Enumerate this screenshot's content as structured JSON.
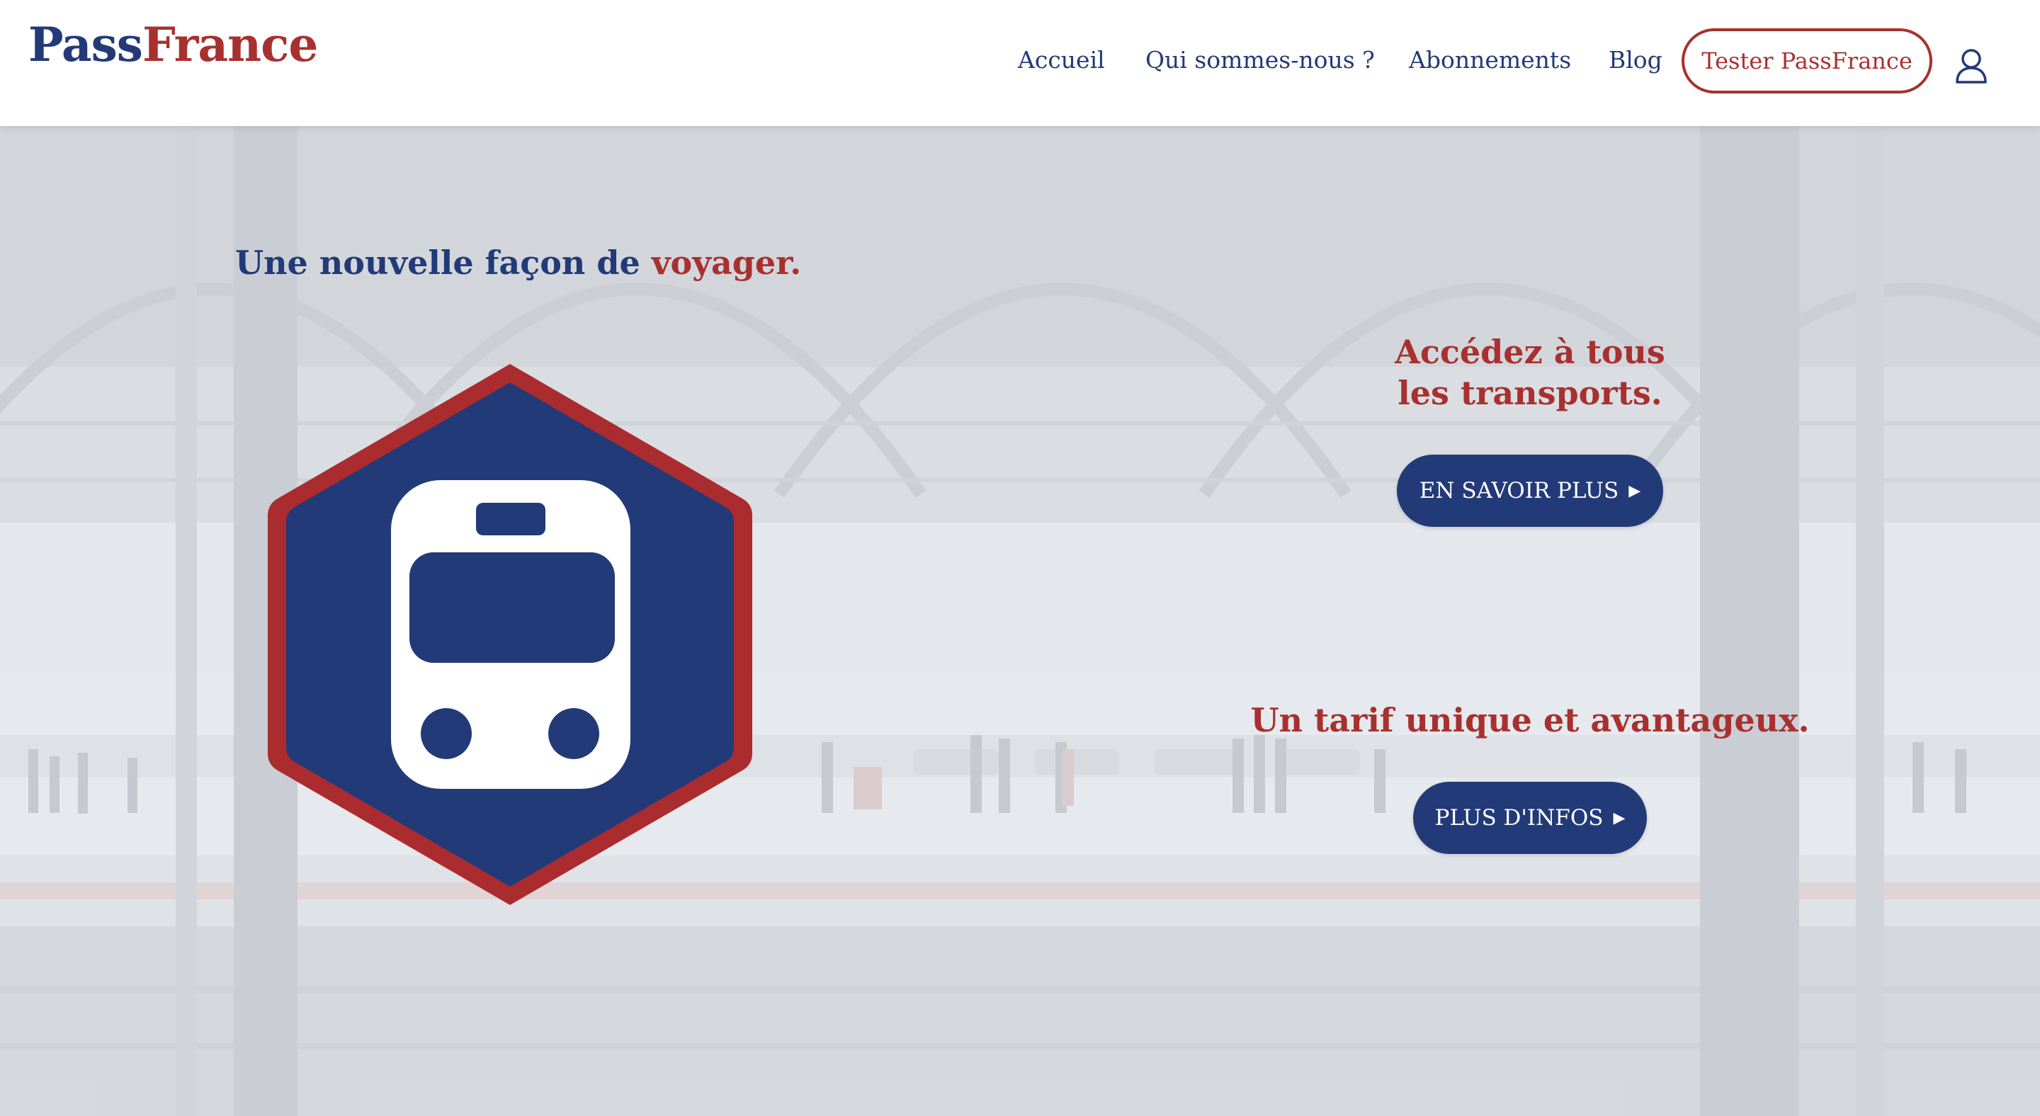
{
  "header": {
    "logo_part1": "Pass",
    "logo_part2": "France",
    "nav": [
      "Accueil",
      "Qui sommes-nous ?",
      "Abonnements",
      "Blog"
    ],
    "cta_label": "Tester PassFrance",
    "user_icon": "user-icon"
  },
  "hero": {
    "tagline_start": "Une nouvelle façon de ",
    "tagline_highlight": "voyager.",
    "badge_icon": "train-icon",
    "feature1_line1": "Accédez à tous",
    "feature1_line2": "les transports.",
    "feature1_button": "EN SAVOIR PLUS",
    "feature2_title": "Un tarif unique et avantageux.",
    "feature2_button": "PLUS D'INFOS"
  },
  "colors": {
    "navy": "#233a78",
    "red": "#a8302f",
    "white": "#ffffff"
  }
}
